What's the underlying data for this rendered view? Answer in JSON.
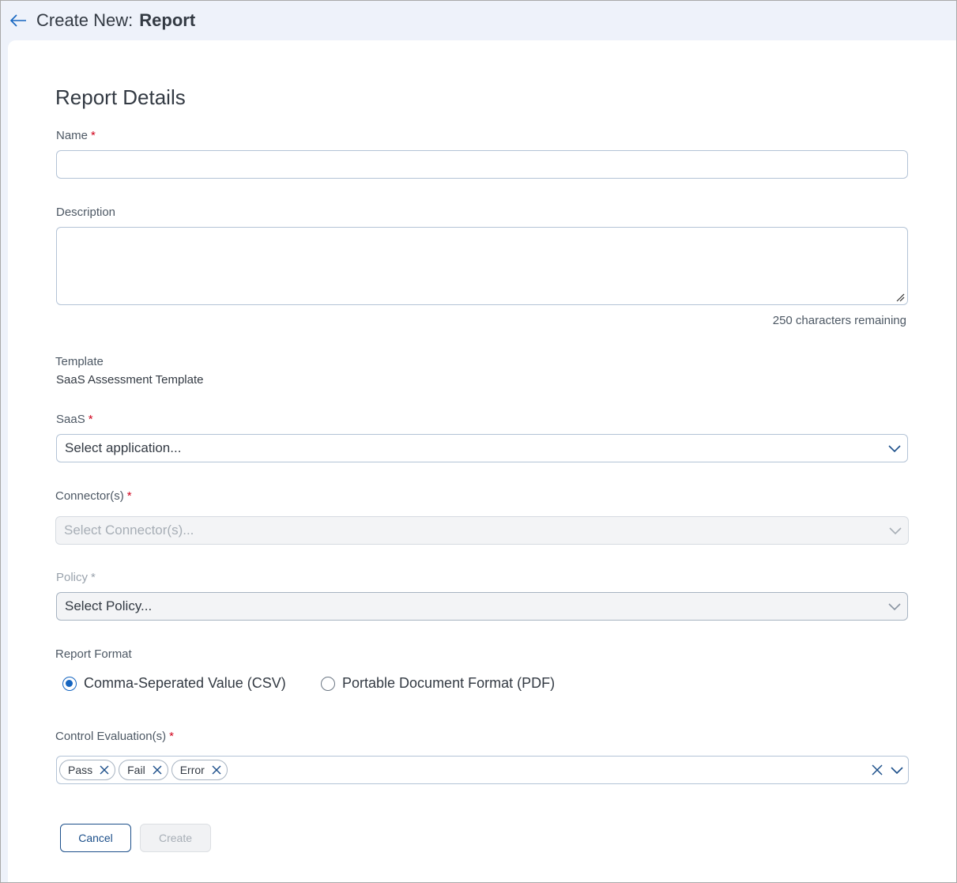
{
  "header": {
    "prefix": "Create New:",
    "title": "Report"
  },
  "section": {
    "title": "Report Details"
  },
  "name_field": {
    "label": "Name",
    "required_mark": "*",
    "value": ""
  },
  "description_field": {
    "label": "Description",
    "value": "",
    "counter": "250 characters remaining"
  },
  "template": {
    "label": "Template",
    "value": "SaaS Assessment Template"
  },
  "saas": {
    "label": "SaaS",
    "required_mark": "*",
    "placeholder": "Select application..."
  },
  "connectors": {
    "label": "Connector(s)",
    "required_mark": "*",
    "placeholder": "Select Connector(s)..."
  },
  "policy": {
    "label": "Policy",
    "required_mark": "*",
    "placeholder": "Select Policy..."
  },
  "report_format": {
    "label": "Report Format",
    "options": [
      "Comma-Seperated Value (CSV)",
      "Portable Document Format (PDF)"
    ],
    "selected": "Comma-Seperated Value (CSV)"
  },
  "control_evaluations": {
    "label": "Control Evaluation(s)",
    "required_mark": "*",
    "chips": [
      "Pass",
      "Fail",
      "Error"
    ]
  },
  "actions": {
    "cancel": "Cancel",
    "create": "Create"
  },
  "colors": {
    "accent": "#1565c0",
    "required": "#d0021b",
    "header_bg": "#eef2fa"
  },
  "icons": {
    "back": "arrow-left-icon",
    "chevron": "chevron-down-icon",
    "remove": "close-icon"
  }
}
